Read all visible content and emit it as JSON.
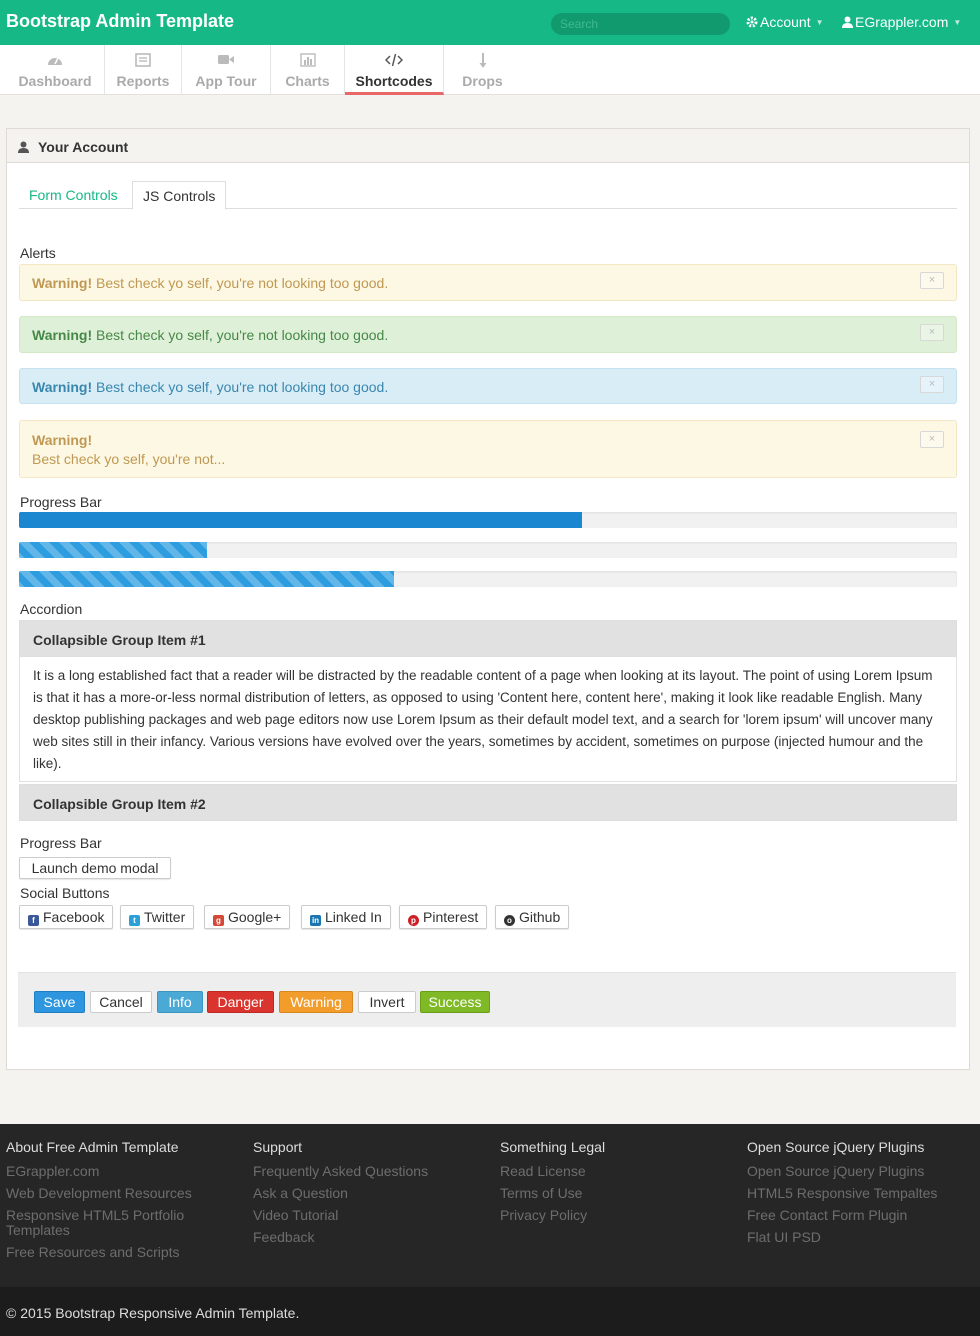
{
  "topbar": {
    "brand": "Bootstrap Admin Template",
    "search_placeholder": "Search",
    "account_label": "Account",
    "user_label": "EGrappler.com"
  },
  "nav": {
    "items": [
      {
        "label": "Dashboard",
        "icon": "dashboard-icon"
      },
      {
        "label": "Reports",
        "icon": "reports-icon"
      },
      {
        "label": "App Tour",
        "icon": "video-camera-icon"
      },
      {
        "label": "Charts",
        "icon": "bar-chart-icon"
      },
      {
        "label": "Shortcodes",
        "icon": "code-icon",
        "active": true
      },
      {
        "label": "Drops",
        "icon": "long-arrow-down-icon"
      }
    ]
  },
  "panel": {
    "title": "Your Account",
    "tabs": [
      {
        "label": "Form Controls"
      },
      {
        "label": "JS Controls",
        "active": true
      }
    ]
  },
  "alerts": {
    "section_label": "Alerts",
    "close_glyph": "×",
    "items": [
      {
        "type": "warning",
        "strong": "Warning!",
        "text": "Best check yo self, you're not looking too good."
      },
      {
        "type": "success",
        "strong": "Warning!",
        "text": "Best check yo self, you're not looking too good."
      },
      {
        "type": "info",
        "strong": "Warning!",
        "text": "Best check yo self, you're not looking too good."
      },
      {
        "type": "warning-block",
        "strong": "Warning!",
        "text": "Best check yo self, you're not..."
      }
    ]
  },
  "progress": {
    "section_label": "Progress Bar",
    "bars": [
      {
        "value": 0.6,
        "style": "solid"
      },
      {
        "value": 0.2,
        "style": "striped"
      },
      {
        "value": 0.4,
        "style": "striped"
      }
    ]
  },
  "accordion": {
    "section_label": "Accordion",
    "items": [
      {
        "title": "Collapsible Group Item #1",
        "expanded": true,
        "body": "It is a long established fact that a reader will be distracted by the readable content of a page when looking at its layout. The point of using Lorem Ipsum is that it has a more-or-less normal distribution of letters, as opposed to using 'Content here, content here', making it look like readable English. Many desktop publishing packages and web page editors now use Lorem Ipsum as their default model text, and a search for 'lorem ipsum' will uncover many web sites still in their infancy. Various versions have evolved over the years, sometimes by accident, sometimes on purpose (injected humour and the like)."
      },
      {
        "title": "Collapsible Group Item #2",
        "expanded": false
      }
    ]
  },
  "modal": {
    "section_label": "Progress Bar",
    "button_label": "Launch demo modal"
  },
  "social": {
    "section_label": "Social Buttons",
    "buttons": [
      {
        "label": "Facebook",
        "icon": "facebook-icon",
        "color": "#3b5998"
      },
      {
        "label": "Twitter",
        "icon": "twitter-icon",
        "color": "#2a9fd8"
      },
      {
        "label": "Google+",
        "icon": "google-plus-icon",
        "color": "#d34836"
      },
      {
        "label": "Linked In",
        "icon": "linkedin-icon",
        "color": "#1a75b0"
      },
      {
        "label": "Pinterest",
        "icon": "pinterest-icon",
        "color": "#cb2027"
      },
      {
        "label": "Github",
        "icon": "github-icon",
        "color": "#333333"
      }
    ]
  },
  "buttons": {
    "save": "Save",
    "cancel": "Cancel",
    "info": "Info",
    "danger": "Danger",
    "warning": "Warning",
    "invert": "Invert",
    "success": "Success"
  },
  "colors": {
    "brand": "#16b985",
    "primary": "#2d96df",
    "info": "#4ba9d5",
    "danger": "#d9352e",
    "warning": "#f29d2b",
    "success": "#7fb925"
  },
  "footer": {
    "columns": [
      {
        "heading": "About Free Admin Template",
        "links": [
          "EGrappler.com",
          "Web Development Resources",
          "Responsive HTML5 Portfolio Templates",
          "Free Resources and Scripts"
        ]
      },
      {
        "heading": "Support",
        "links": [
          "Frequently Asked Questions",
          "Ask a Question",
          "Video Tutorial",
          "Feedback"
        ]
      },
      {
        "heading": "Something Legal",
        "links": [
          "Read License",
          "Terms of Use",
          "Privacy Policy"
        ]
      },
      {
        "heading": "Open Source jQuery Plugins",
        "links": [
          "Open Source jQuery Plugins",
          "HTML5 Responsive Tempaltes",
          "Free Contact Form Plugin",
          "Flat UI PSD"
        ]
      }
    ],
    "copyright": "© 2015 Bootstrap Responsive Admin Template."
  }
}
